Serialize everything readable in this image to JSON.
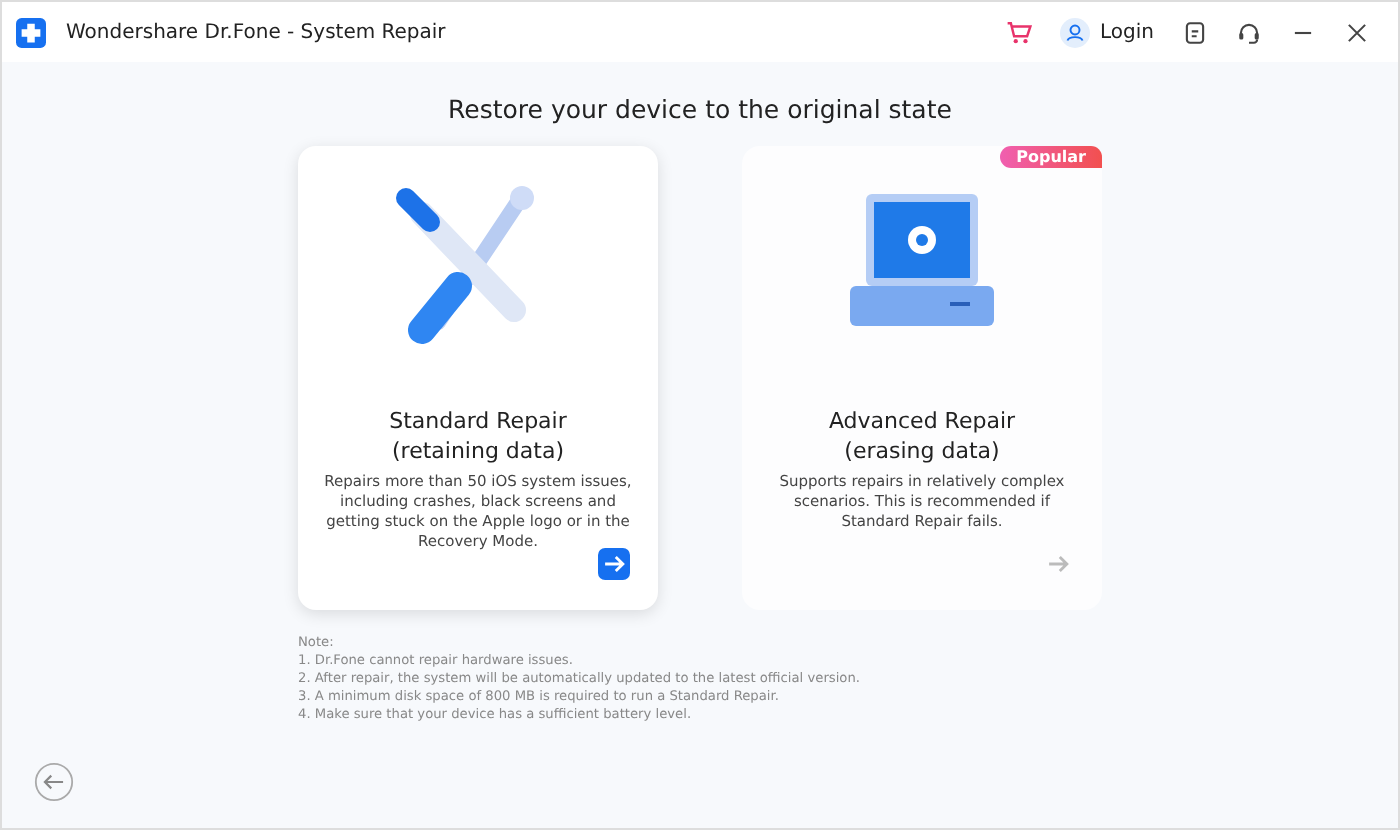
{
  "window": {
    "title": "Wondershare Dr.Fone - System Repair",
    "login": "Login"
  },
  "heading": "Restore your device to the original state",
  "cards": [
    {
      "kind": "tools",
      "title": "Standard Repair",
      "subtitle": "(retaining data)",
      "description": "Repairs more than 50 iOS system issues, including crashes, black screens and getting stuck on the Apple logo or in the Recovery Mode.",
      "selected": true
    },
    {
      "kind": "computer",
      "title": "Advanced Repair",
      "subtitle": "(erasing data)",
      "description": "Supports repairs in relatively complex scenarios. This is recommended if Standard Repair fails.",
      "selected": false,
      "badge": "Popular"
    }
  ],
  "notes": [
    "Note:",
    "1. Dr.Fone cannot repair hardware issues.",
    "2. After repair, the system will be automatically updated to the latest official version.",
    "3. A minimum disk space of 800 MB is required to run a Standard Repair.",
    "4. Make sure that your device has a sufficient battery level."
  ]
}
